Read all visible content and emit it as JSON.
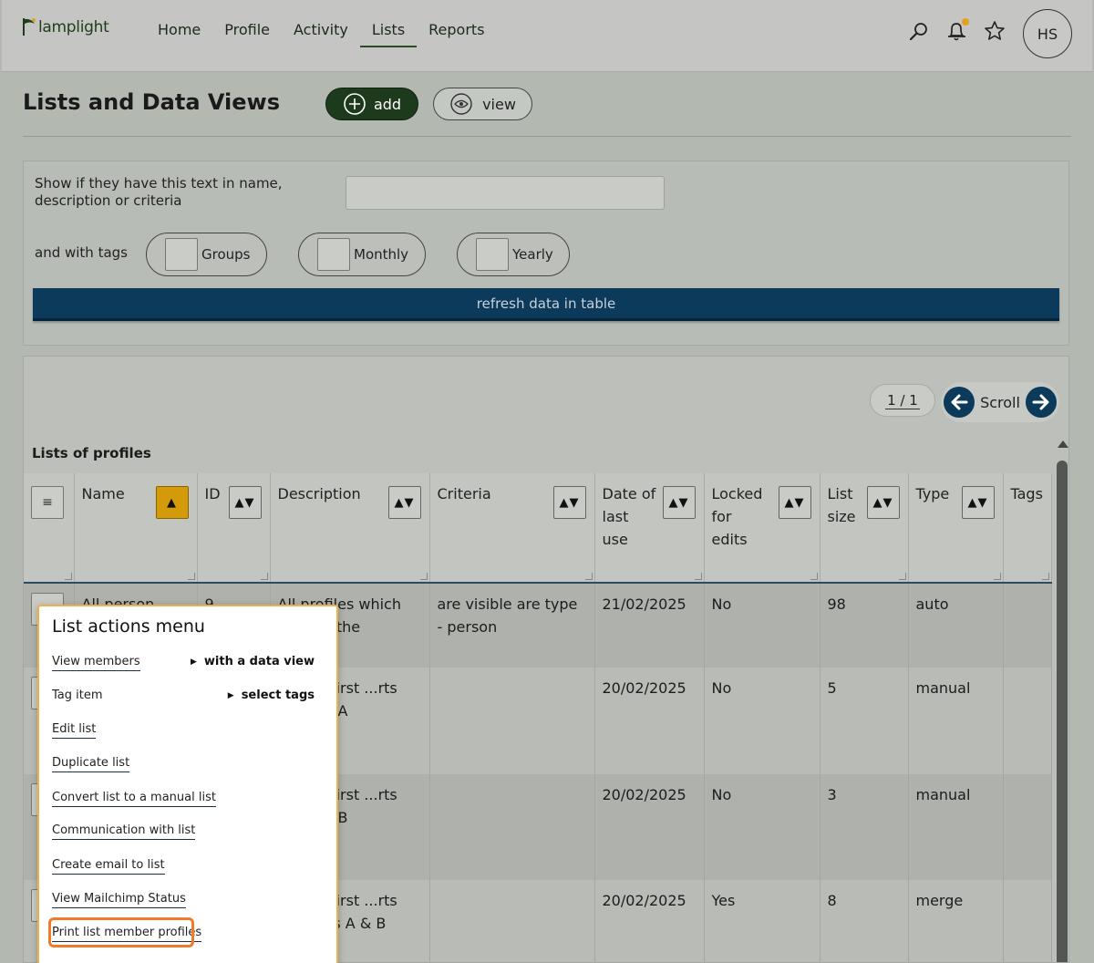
{
  "app": {
    "logo_text": "lamplight",
    "avatar_initials": "HS",
    "nav": [
      {
        "label": "Home"
      },
      {
        "label": "Profile"
      },
      {
        "label": "Activity"
      },
      {
        "label": "Lists",
        "active": true
      },
      {
        "label": "Reports"
      }
    ],
    "icons": [
      "search-icon",
      "bell-icon",
      "star-icon"
    ],
    "accent": "#1e3a1d",
    "primary_blue": "#0c3a5a",
    "sort_active": "#d39b0a",
    "highlight": "#f07b28"
  },
  "header": {
    "title": "Lists and Data Views",
    "add_label": "add",
    "view_label": "view"
  },
  "filter": {
    "text_label": "Show if they have this text in name, description or criteria",
    "text_value": "",
    "tags_label": "and with tags",
    "tags": [
      "Groups",
      "Monthly",
      "Yearly"
    ],
    "refresh_label": "refresh data in table"
  },
  "table": {
    "pager": "1 / 1",
    "scroll_label": "Scroll",
    "section_title": "Lists of profiles",
    "columns": [
      "",
      "Name",
      "ID",
      "Description",
      "Criteria",
      "Date of last use",
      "Locked for edits",
      "List size",
      "Type",
      "Tags"
    ],
    "rows": [
      {
        "name": "All person",
        "id": "9",
        "description": "All profiles which ...on' in the",
        "criteria": "are visible are type - person",
        "date": "21/02/2025",
        "locked": "No",
        "size": "98",
        "type": "auto",
        "tags": ""
      },
      {
        "name": "",
        "id": "",
        "description": "...hose first ...rts with ...r A",
        "criteria": "",
        "date": "20/02/2025",
        "locked": "No",
        "size": "5",
        "type": "manual",
        "tags": ""
      },
      {
        "name": "",
        "id": "",
        "description": "...hose first ...rts with ...r B",
        "criteria": "",
        "date": "20/02/2025",
        "locked": "No",
        "size": "3",
        "type": "manual",
        "tags": ""
      },
      {
        "name": "",
        "id": "",
        "description": "...hose first ...rts with ...rs A & B",
        "criteria": "",
        "date": "20/02/2025",
        "locked": "Yes",
        "size": "8",
        "type": "merge",
        "tags": ""
      }
    ]
  },
  "popup": {
    "title": "List actions menu",
    "items": [
      {
        "label": "View members",
        "sub": "with a data view"
      },
      {
        "label": "Tag item",
        "sub": "select tags"
      },
      {
        "label": "Edit list"
      },
      {
        "label": "Duplicate list"
      },
      {
        "label": "Convert list to a manual list"
      },
      {
        "label": "Communication with list"
      },
      {
        "label": "Create email to list"
      },
      {
        "label": "View Mailchimp Status"
      },
      {
        "label": "Print list member profiles"
      }
    ]
  }
}
